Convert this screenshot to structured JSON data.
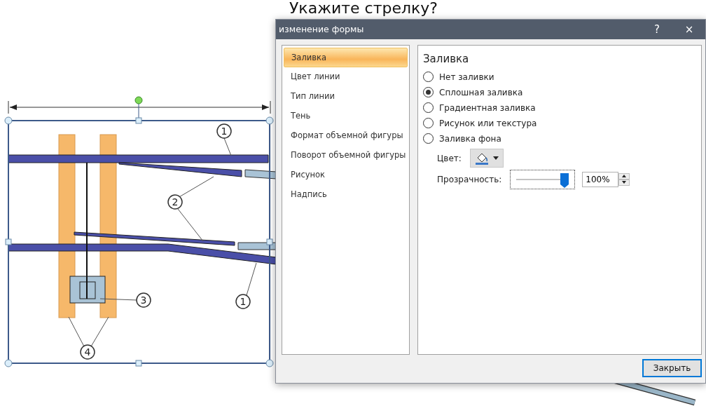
{
  "slide": {
    "title": "Укажите стрелку?",
    "callouts": [
      "1",
      "2",
      "3",
      "1",
      "4"
    ]
  },
  "dialog": {
    "title": "изменение формы",
    "help": "?",
    "close": "×",
    "categories": [
      {
        "label": "Заливка",
        "selected": true
      },
      {
        "label": "Цвет линии",
        "selected": false
      },
      {
        "label": "Тип линии",
        "selected": false
      },
      {
        "label": "Тень",
        "selected": false
      },
      {
        "label": "Формат объемной фигуры",
        "selected": false
      },
      {
        "label": "Поворот объемной фигуры",
        "selected": false
      },
      {
        "label": "Рисунок",
        "selected": false
      },
      {
        "label": "Надпись",
        "selected": false
      }
    ],
    "panel_title": "Заливка",
    "fill_options": [
      {
        "label": "Нет заливки",
        "selected": false
      },
      {
        "label": "Сплошная заливка",
        "selected": true
      },
      {
        "label": "Градиентная заливка",
        "selected": false
      },
      {
        "label": "Рисунок или текстура",
        "selected": false
      },
      {
        "label": "Заливка фона",
        "selected": false
      }
    ],
    "color_label": "Цвет:",
    "transparency": {
      "label": "Прозрачность:",
      "level": 1,
      "value": "100%"
    },
    "close_button": "Закрыть"
  }
}
